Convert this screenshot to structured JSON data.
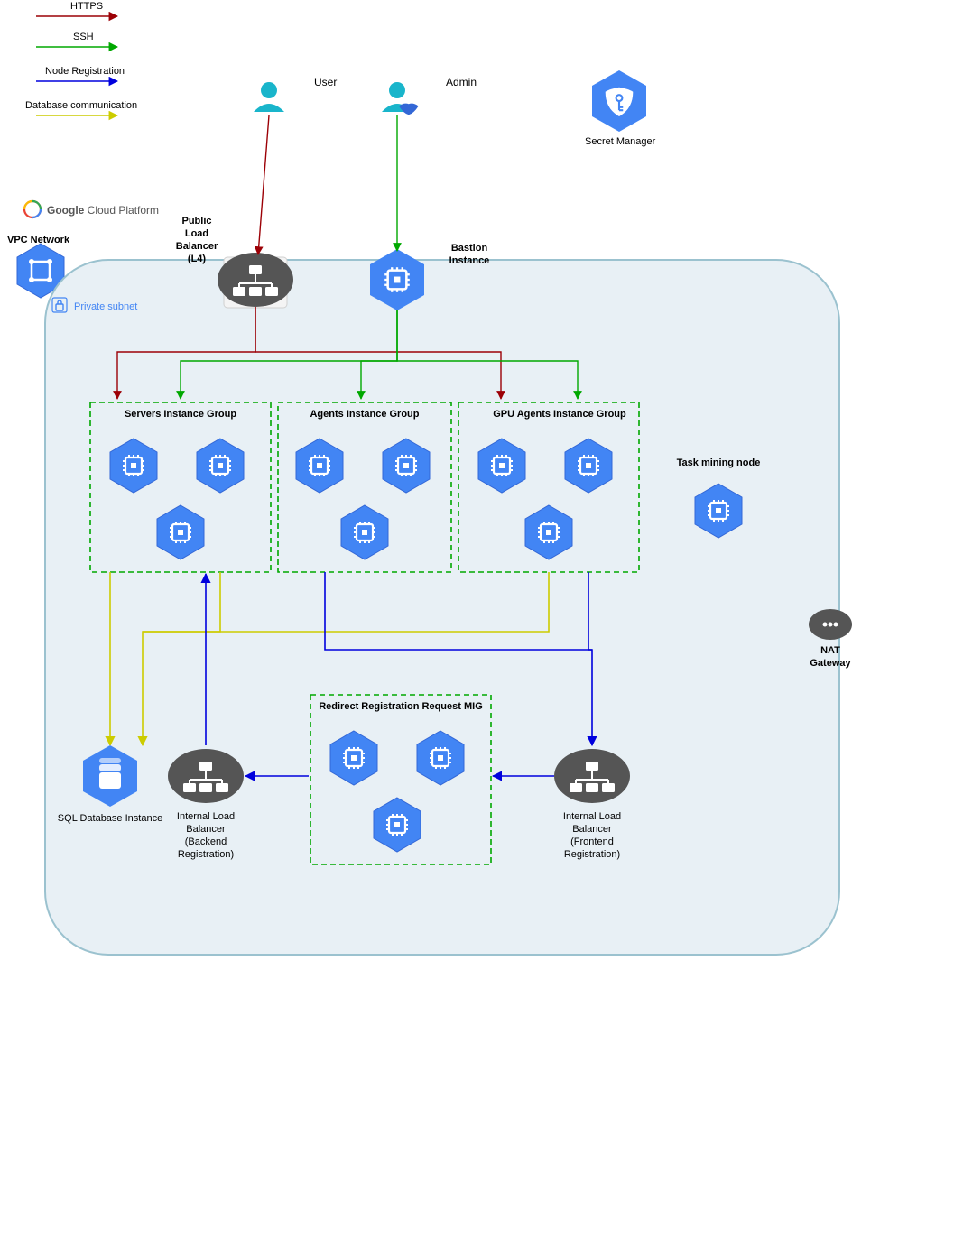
{
  "legend": {
    "https": "HTTPS",
    "ssh": "SSH",
    "node_reg": "Node Registration",
    "db_comm": "Database communication"
  },
  "actors": {
    "user": "User",
    "admin": "Admin"
  },
  "gcp": {
    "brand1": "Google",
    "brand2": " Cloud Platform"
  },
  "secret_manager": "Secret Manager",
  "vpc": "VPC Network",
  "private_subnet": "Private subnet",
  "public_lb_l1": "Public",
  "public_lb_l2": "Load",
  "public_lb_l3": "Balancer",
  "public_lb_l4": "(L4)",
  "bastion_l1": "Bastion",
  "bastion_l2": "Instance",
  "group_servers": "Servers Instance Group",
  "group_agents": "Agents Instance Group",
  "group_gpu": "GPU Agents Instance Group",
  "task_mining": "Task mining node",
  "nat_l1": "NAT",
  "nat_l2": "Gateway",
  "redirect_mig": "Redirect Registration Request MIG",
  "sql_db": "SQL Database Instance",
  "ilb_back_l1": "Internal Load",
  "ilb_back_l2": "Balancer",
  "ilb_back_l3": "(Backend",
  "ilb_back_l4": "Registration)",
  "ilb_front_l1": "Internal Load",
  "ilb_front_l2": "Balancer",
  "ilb_front_l3": "(Frontend",
  "ilb_front_l4": "Registration)",
  "colors": {
    "https": "#9c0006",
    "ssh": "#00a800",
    "node_reg": "#0000dd",
    "db_comm": "#cccc00",
    "blue": "#4285f4",
    "blue_dark": "#3367d6",
    "grey": "#555555",
    "panel": "#e8f0f5",
    "panel_border": "#9bc2cf"
  }
}
